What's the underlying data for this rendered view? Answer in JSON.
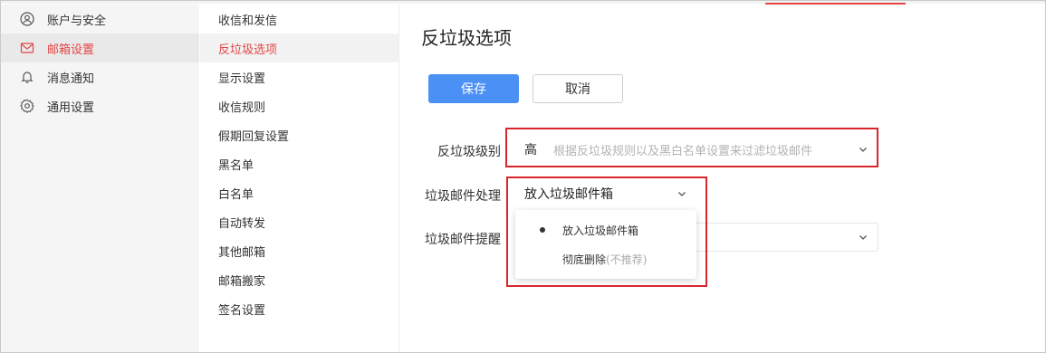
{
  "sidebar": {
    "items": [
      {
        "label": "账户与安全",
        "icon": "account-icon"
      },
      {
        "label": "邮箱设置",
        "icon": "mail-icon"
      },
      {
        "label": "消息通知",
        "icon": "bell-icon"
      },
      {
        "label": "通用设置",
        "icon": "gear-icon"
      }
    ]
  },
  "subnav": {
    "items": [
      {
        "label": "收信和发信"
      },
      {
        "label": "反垃圾选项"
      },
      {
        "label": "显示设置"
      },
      {
        "label": "收信规则"
      },
      {
        "label": "假期回复设置"
      },
      {
        "label": "黑名单"
      },
      {
        "label": "白名单"
      },
      {
        "label": "自动转发"
      },
      {
        "label": "其他邮箱"
      },
      {
        "label": "邮箱搬家"
      },
      {
        "label": "签名设置"
      }
    ]
  },
  "main": {
    "title": "反垃圾选项",
    "save_label": "保存",
    "cancel_label": "取消",
    "level": {
      "label": "反垃圾级别",
      "value": "高",
      "hint": "根据反垃圾规则以及黑白名单设置来过滤垃圾邮件"
    },
    "handling": {
      "label": "垃圾邮件处理",
      "value": "放入垃圾邮件箱",
      "options": [
        {
          "label": "放入垃圾邮件箱",
          "note": "",
          "selected": true
        },
        {
          "label": "彻底删除",
          "note": "(不推荐)",
          "selected": false
        }
      ]
    },
    "reminder": {
      "label": "垃圾邮件提醒"
    }
  },
  "colors": {
    "accent_red": "#e64545",
    "primary_blue": "#4a90f5",
    "highlight_red": "#d8262c"
  }
}
